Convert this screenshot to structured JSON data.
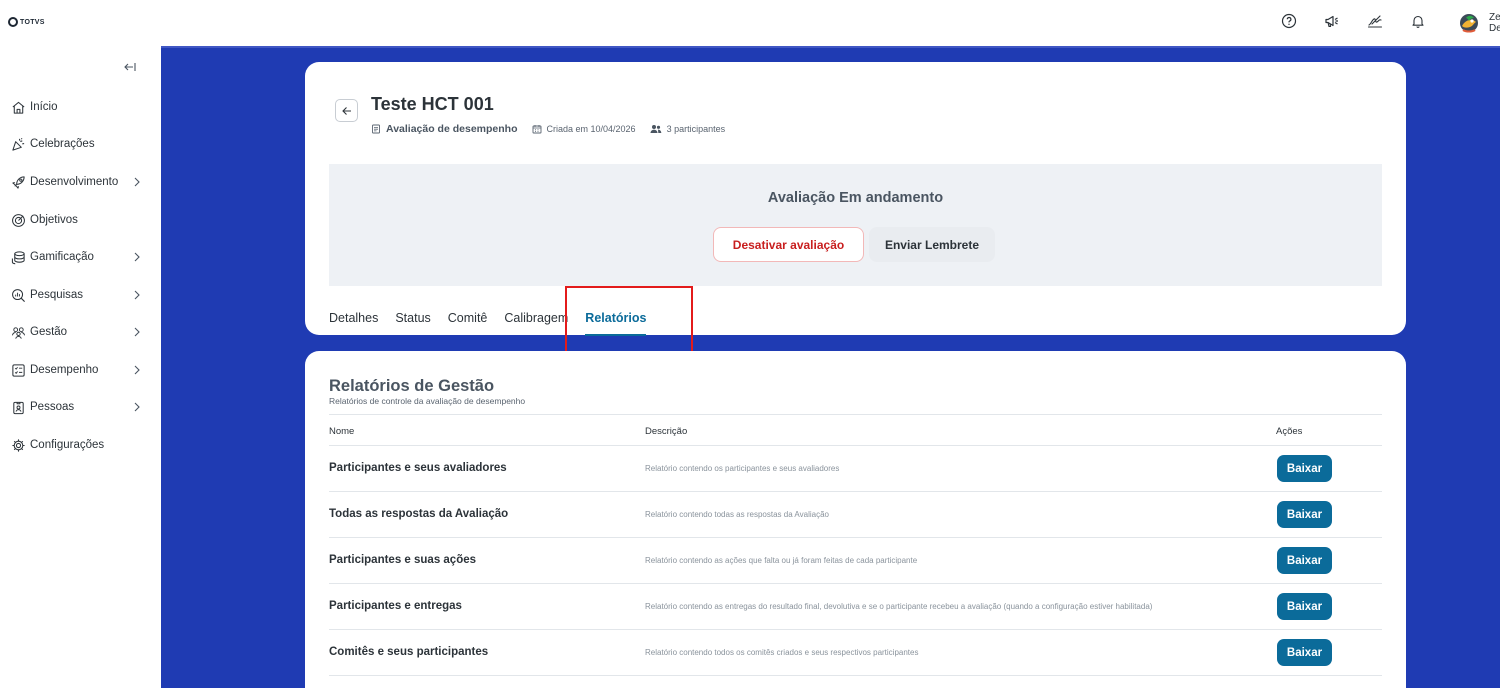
{
  "brand": {
    "logo_text": "TOTVS"
  },
  "header": {
    "icons": [
      "help-icon",
      "megaphone-icon",
      "signature-icon",
      "bell-icon"
    ],
    "user_name": "Ze",
    "user_sub": "De"
  },
  "sidebar": {
    "items": [
      {
        "label": "Início",
        "icon": "home-icon",
        "has_chevron": false
      },
      {
        "label": "Celebrações",
        "icon": "party-icon",
        "has_chevron": false
      },
      {
        "label": "Desenvolvimento",
        "icon": "rocket-icon",
        "has_chevron": true
      },
      {
        "label": "Objetivos",
        "icon": "target-icon",
        "has_chevron": false
      },
      {
        "label": "Gamificação",
        "icon": "coins-icon",
        "has_chevron": true
      },
      {
        "label": "Pesquisas",
        "icon": "search-poll-icon",
        "has_chevron": true
      },
      {
        "label": "Gestão",
        "icon": "people-icon",
        "has_chevron": true
      },
      {
        "label": "Desempenho",
        "icon": "checklist-icon",
        "has_chevron": true
      },
      {
        "label": "Pessoas",
        "icon": "id-badge-icon",
        "has_chevron": true
      },
      {
        "label": "Configurações",
        "icon": "gear-icon",
        "has_chevron": false
      }
    ]
  },
  "page": {
    "title": "Teste HCT 001",
    "type_label": "Avaliação de desempenho",
    "created_label": "Criada em 10/04/2026",
    "participants_label": "3 participantes"
  },
  "status": {
    "title": "Avaliação Em andamento",
    "deactivate_label": "Desativar avaliação",
    "remind_label": "Enviar Lembrete"
  },
  "tabs": [
    {
      "label": "Detalhes",
      "active": false
    },
    {
      "label": "Status",
      "active": false
    },
    {
      "label": "Comitê",
      "active": false
    },
    {
      "label": "Calibragem",
      "active": false
    },
    {
      "label": "Relatórios",
      "active": true
    }
  ],
  "reports": {
    "title": "Relatórios de Gestão",
    "subtitle": "Relatórios de controle da avaliação de desempenho",
    "columns": {
      "name": "Nome",
      "description": "Descrição",
      "actions": "Ações"
    },
    "rows": [
      {
        "name": "Participantes e seus avaliadores",
        "description": "Relatório contendo os participantes e seus avaliadores",
        "action": "Baixar"
      },
      {
        "name": "Todas as respostas da Avaliação",
        "description": "Relatório contendo todas as respostas da Avaliação",
        "action": "Baixar"
      },
      {
        "name": "Participantes e suas ações",
        "description": "Relatório contendo as ações que falta ou já foram feitas de cada participante",
        "action": "Baixar"
      },
      {
        "name": "Participantes e entregas",
        "description": "Relatório contendo as entregas do resultado final, devolutiva e se o participante recebeu a avaliação (quando a configuração estiver habilitada)",
        "action": "Baixar"
      },
      {
        "name": "Comitês e seus participantes",
        "description": "Relatório contendo todos os comitês criados e seus respectivos participantes",
        "action": "Baixar"
      }
    ]
  },
  "colors": {
    "main_bg": "#1f3bb3",
    "accent": "#0b6b9a",
    "danger": "#c81e1e",
    "highlight": "#e31b1b"
  }
}
